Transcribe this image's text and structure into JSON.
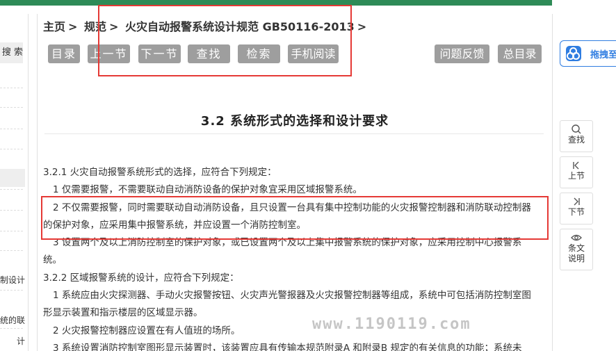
{
  "sidebar": {
    "search_label": "搜 索",
    "items": [
      "制设计",
      "统的联",
      "计"
    ]
  },
  "breadcrumb": {
    "home": "主页",
    "sep": ">",
    "spec": "规范",
    "standard": "火灾自动报警系统设计规范 GB50116-2013",
    "trail": ">"
  },
  "toolbar": {
    "toc": "目录",
    "prev": "上一节",
    "next": "下一节",
    "find": "查找",
    "search": "检索",
    "mobile": "手机阅读",
    "feedback": "问题反馈",
    "all_toc": "总目录"
  },
  "section_title": "3.2 系统形式的选择和设计要求",
  "content": {
    "p1": "3.2.1 火灾自动报警系统形式的选择，应符合下列规定：",
    "p2": "1 仅需要报警，不需要联动自动消防设备的保护对象宜采用区域报警系统。",
    "p3": "2 不仅需要报警，同时需要联动自动消防设备，且只设置一台具有集中控制功能的火灾报警控制器和消防联动控制器的保护对象，应采用集中报警系统，并应设置一个消防控制室。",
    "p4": "3 设置两个及以上消防控制室的保护对象，或已设置两个及以上集中报警系统的保护对象，应采用控制中心报警系统。",
    "p5": "3.2.2 区域报警系统的设计，应符合下列规定：",
    "p6": "1 系统应由火灾探测器、手动火灾报警按钮、火灾声光警报器及火灾报警控制器等组成，系统中可包括消防控制室图形显示装置和指示楼层的区域显示器。",
    "p7": "2 火灾报警控制器应设置在有人值班的场所。",
    "p8": "3 系统设置消防控制室图形显示装置时，该装置应具有传输本规范附录A 和附录B 规定的有关信息的功能；系统未"
  },
  "watermark": "www.1190119.com",
  "right_panel": {
    "baidu_label": "拖拽至",
    "tools": [
      {
        "label": "查找"
      },
      {
        "label": "上节"
      },
      {
        "label": "下节"
      },
      {
        "label": "条文说明"
      }
    ]
  },
  "colors": {
    "button_gray": "#9e9e9e",
    "annotation_red": "#e53935",
    "baidu_blue": "#2f7de1",
    "top_bar_green": "#2e8b57"
  }
}
